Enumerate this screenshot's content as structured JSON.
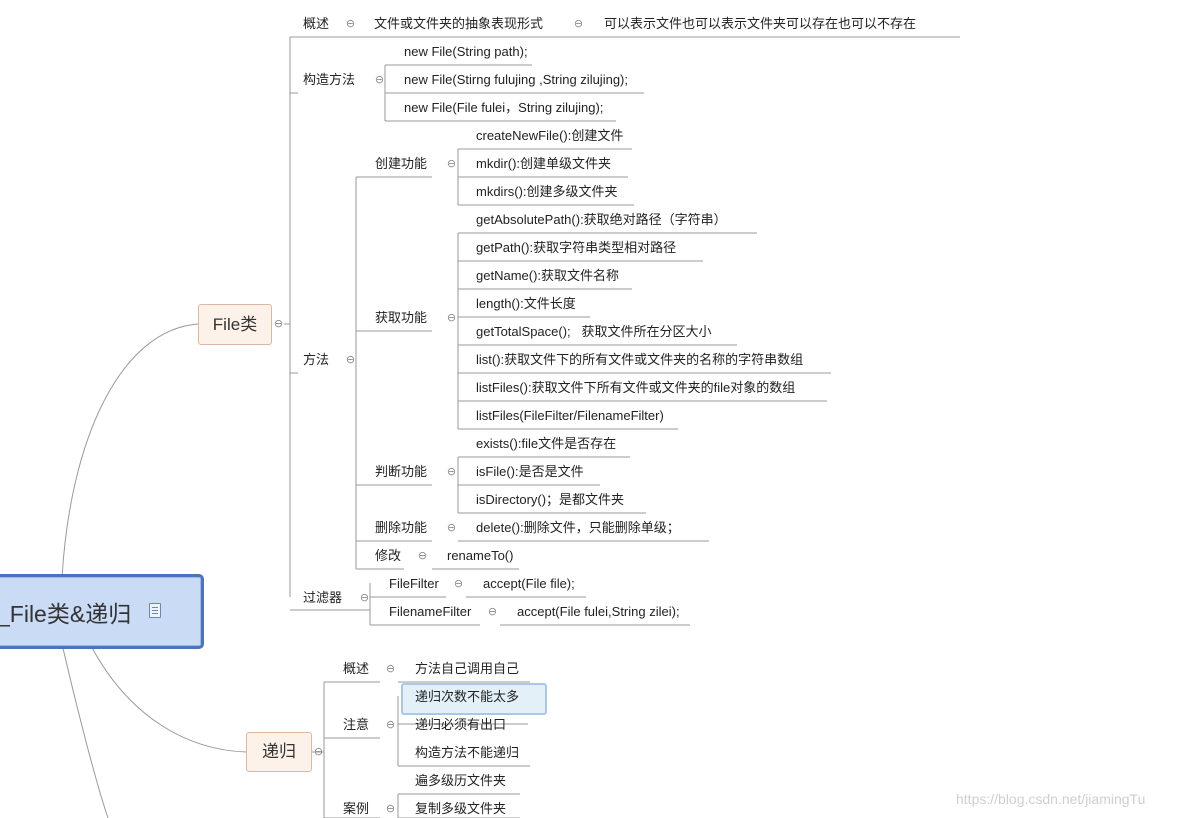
{
  "root": {
    "label": "_File类&递归"
  },
  "file_topic": {
    "label": "File类"
  },
  "recursion_topic": {
    "label": "递归"
  },
  "file_branches": {
    "overview": {
      "label": "概述",
      "items": [
        "文件或文件夹的抽象表现形式",
        "可以表示文件也可以表示文件夹可以存在也可以不存在"
      ]
    },
    "constructor": {
      "label": "构造方法",
      "items": [
        "new File(String path);",
        "new File(Stirng fulujing ,String zilujing);",
        "new File(File fulei，String zilujing);"
      ]
    },
    "methods": {
      "label": "方法",
      "create": {
        "label": "创建功能",
        "items": [
          "createNewFile():创建文件",
          "mkdir():创建单级文件夹",
          "mkdirs():创建多级文件夹"
        ]
      },
      "get": {
        "label": "获取功能",
        "items": [
          "getAbsolutePath():获取绝对路径（字符串）",
          "getPath():获取字符串类型相对路径",
          "getName():获取文件名称",
          "length():文件长度",
          "getTotalSpace();   获取文件所在分区大小",
          "list():获取文件下的所有文件或文件夹的名称的字符串数组",
          "listFiles():获取文件下所有文件或文件夹的file对象的数组",
          "listFiles(FileFilter/FilenameFilter)"
        ]
      },
      "judge": {
        "label": "判断功能",
        "items": [
          "exists():file文件是否存在",
          "isFile():是否是文件",
          "isDirectory()；是都文件夹"
        ]
      },
      "delete": {
        "label": "删除功能",
        "items": [
          "delete():删除文件，只能删除单级；"
        ]
      },
      "modify": {
        "label": "修改",
        "items": [
          "renameTo()"
        ]
      }
    },
    "filter": {
      "label": "过滤器",
      "filefilter": {
        "label": "FileFilter",
        "items": [
          "accept(File file);"
        ]
      },
      "filenamefilter": {
        "label": "FilenameFilter",
        "items": [
          "accept(File fulei,String zilei);"
        ]
      }
    }
  },
  "recursion_branches": {
    "overview": {
      "label": "概述",
      "items": [
        "方法自己调用自己"
      ]
    },
    "notes": {
      "label": "注意",
      "items": [
        "递归次数不能太多",
        "递归必须有出口",
        "构造方法不能递归"
      ]
    },
    "cases": {
      "label": "案例",
      "items": [
        "遍多级历文件夹",
        "复制多级文件夹"
      ]
    }
  },
  "collapse_symbol": "⊖",
  "watermark": "https://blog.csdn.net/jiamingTu",
  "colors": {
    "root_fill": "#c9dbf5",
    "root_border": "#4a73c0",
    "topic_fill": "#fdf2ea",
    "line": "#999999"
  }
}
